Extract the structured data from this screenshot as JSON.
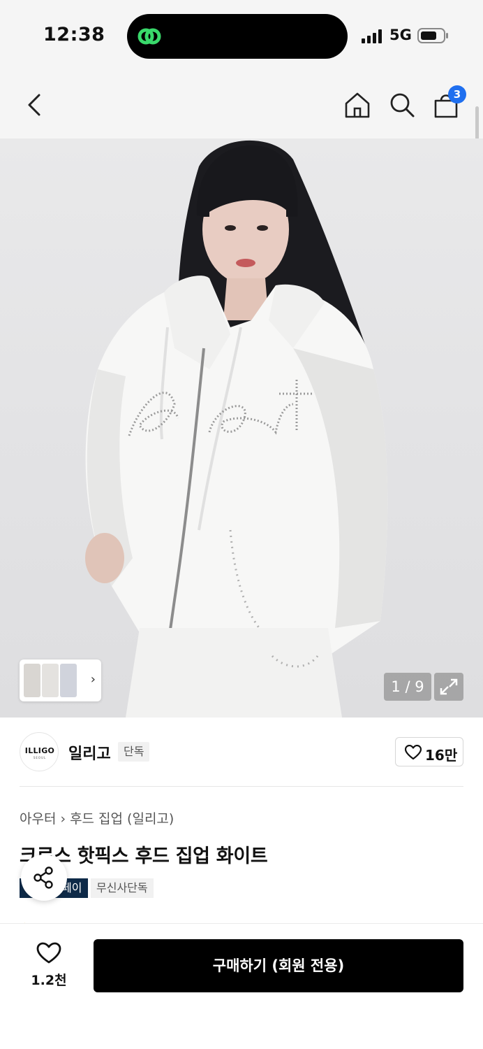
{
  "status_bar": {
    "time": "12:38",
    "network": "5G"
  },
  "nav": {
    "cart_count": "3"
  },
  "gallery": {
    "counter": "1 / 9",
    "thumbnail_arrow": "›"
  },
  "brand": {
    "logo_text": "ILLIGO",
    "logo_subtext": "SEOUL",
    "name": "일리고",
    "tag": "단독",
    "likes": "16만"
  },
  "product": {
    "breadcrumb": [
      "아우터",
      "후드 집업 (일리고)"
    ],
    "title": "크로스 핫픽스 후드 집업 화이트",
    "tags": [
      "페이",
      "무신사단독"
    ]
  },
  "bottom_bar": {
    "wish_count": "1.2천",
    "buy_label": "구매하기 (회원 전용)"
  },
  "colors": {
    "accent": "#1f6fef",
    "dark_tag": "#0e2a48",
    "island_icon": "#39d96b"
  },
  "icons": [
    "back-icon",
    "home-icon",
    "search-icon",
    "shopping-bag-icon",
    "expand-icon",
    "share-icon",
    "heart-icon"
  ]
}
